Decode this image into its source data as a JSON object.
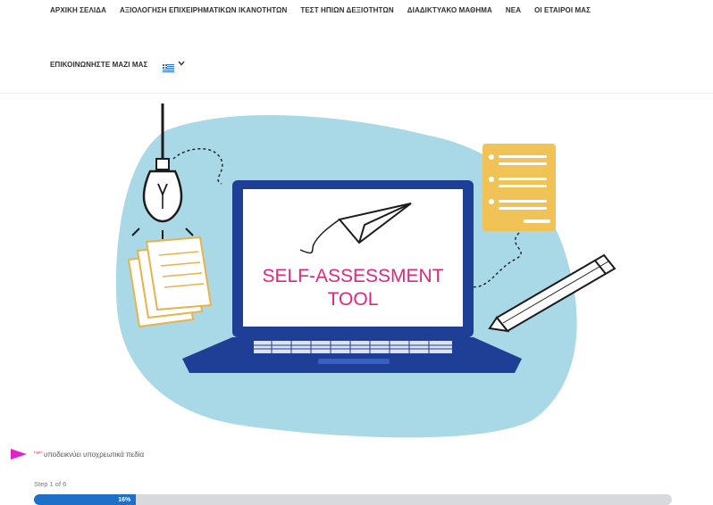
{
  "nav": {
    "row1": [
      "ΑΡΧΙΚΗ ΣΕΛΙΔΑ",
      "ΑΞΙΟΛΟΓΗΣΗ ΕΠΙΧΕΙΡΗΜΑΤΙΚΩΝ ΙΚΑΝΟΤΗΤΩΝ",
      "ΤΕΣΤ ΗΠΙΩΝ ΔΕΞΙΟΤΗΤΩΝ",
      "ΔΙΑΔΙΚΤΥΑΚΟ ΜΑΘΗΜΑ",
      "ΝΕΑ",
      "ΟΙ ΕΤΑΙΡΟΙ ΜΑΣ"
    ],
    "row2": [
      "ΕΠΙΚΟΙΝΩΝΗΣΤΕ ΜΑΖΙ ΜΑΣ"
    ],
    "language_icon": "greek-flag-icon",
    "dropdown_icon": "chevron-down-icon"
  },
  "hero": {
    "screen_line1": "SELF-ASSESSMENT",
    "screen_line2": "TOOL",
    "colors": {
      "blob": "#a9d8e6",
      "laptop": "#1f3f96",
      "title": "#e0287a",
      "document": "#f1c256"
    }
  },
  "form": {
    "required_star": "\"*\"",
    "required_text": " υποδεικνύει υποχρεωτικά πεδία",
    "step_label": "Step 1 of 6",
    "progress_value": 16,
    "progress_label": "16%",
    "progress_color": "#1e6fc8"
  }
}
